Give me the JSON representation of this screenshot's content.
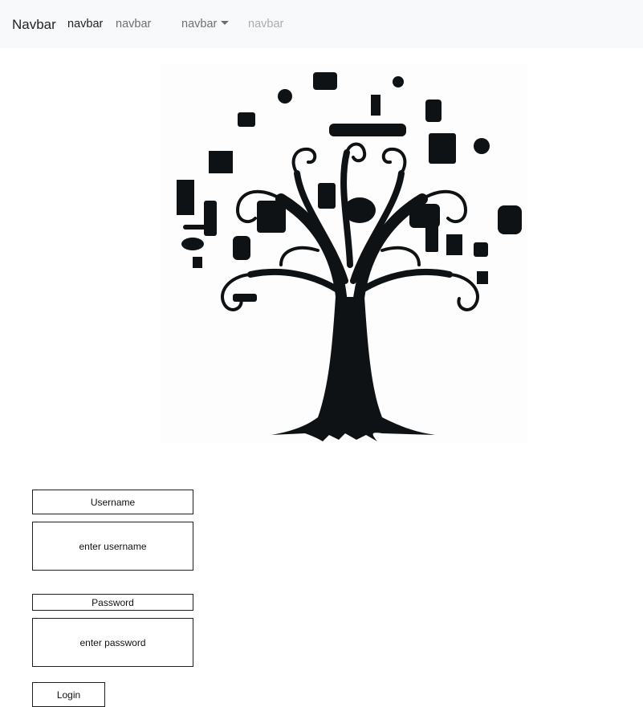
{
  "navbar": {
    "brand": "Navbar",
    "links": [
      "navbar",
      "navbar"
    ],
    "dropdown": {
      "label": "navbar",
      "icon": "caret-down-icon"
    },
    "disabled_link": "navbar"
  },
  "hero": {
    "image_description": "black silhouette tree with household objects as leaves",
    "icon": "tree-icon"
  },
  "form": {
    "username_label": "Username",
    "username_placeholder": "enter username",
    "password_label": "Password",
    "password_placeholder": "enter password",
    "login_label": "Login"
  },
  "colors": {
    "navbar_bg": "#f8f9fa",
    "border": "#1e1e1e",
    "tree": "#0f1214"
  }
}
